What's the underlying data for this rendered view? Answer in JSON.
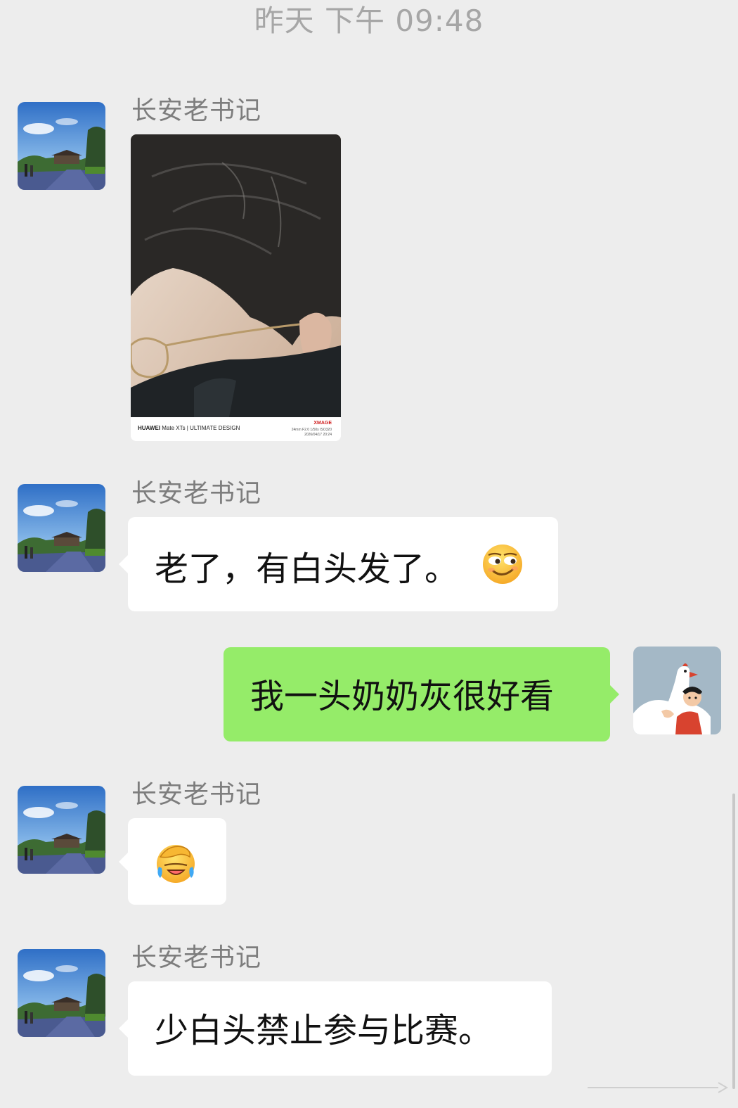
{
  "chat": {
    "timestamp": "昨天 下午 09:48",
    "contact_name": "长安老书记",
    "messages": [
      {
        "sender": "长安老书记",
        "type": "image",
        "image": {
          "brand": "HUAWEI",
          "model": "Mate XTs | ULTIMATE DESIGN",
          "logo": "XMAGE",
          "meta_line1": "24mm  F2.0  1/50s  ISO320",
          "meta_line2": "2026/04/17  20:24"
        }
      },
      {
        "sender": "长安老书记",
        "type": "text",
        "text": "老了，有白头发了。",
        "emoji": "smirk-face-emoji"
      },
      {
        "sender": "me",
        "type": "text",
        "text": "我一头奶奶灰很好看"
      },
      {
        "sender": "长安老书记",
        "type": "emoji",
        "emoji": "facepalm-laugh-emoji"
      },
      {
        "sender": "长安老书记",
        "type": "text",
        "text": "少白头禁止参与比赛。"
      }
    ]
  },
  "colors": {
    "background": "#ededed",
    "bubble_left": "#ffffff",
    "bubble_right": "#95ec69",
    "timestamp_text": "#a6a6a6",
    "name_text": "#7d7d7d"
  }
}
